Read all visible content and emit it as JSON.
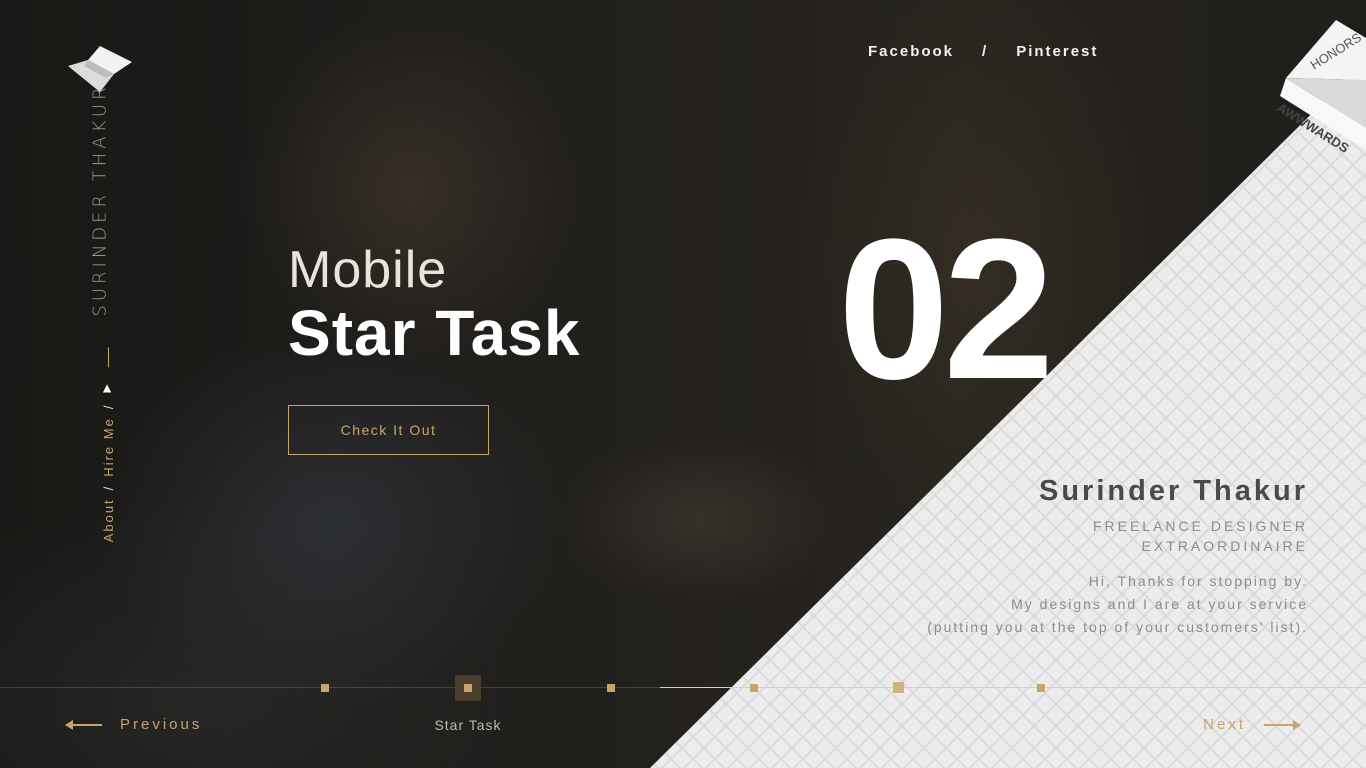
{
  "brand": {
    "name_vertical": "SURINDER THAKUR",
    "logo_icon": "s-monogram-logo"
  },
  "side_nav": {
    "about": "About",
    "hire": "Hire Me",
    "separator": "/",
    "home_icon": "home-icon"
  },
  "social": {
    "facebook": "Facebook",
    "separator": "/",
    "pinterest": "Pinterest"
  },
  "ribbon": {
    "top": "HONORS",
    "bottom": "AWWWARDS"
  },
  "hero": {
    "kicker": "Mobile",
    "title": "Star Task",
    "cta": "Check It Out",
    "number": "02"
  },
  "bio": {
    "name": "Surinder Thakur",
    "role_line1": "FREELANCE DESIGNER",
    "role_line2": "EXTRAORDINAIRE",
    "msg_line1": "Hi, Thanks for stopping by.",
    "msg_line2": "My designs and I are at your service",
    "msg_line3": "(putting you at the top of your customers' list)."
  },
  "footer_nav": {
    "previous": "Previous",
    "next": "Next",
    "current": "Star Task",
    "slide_count": 6,
    "active_slide": 2
  },
  "colors": {
    "accent_gold": "#c8a56a",
    "panel_light": "#ececec",
    "dark_bg": "#2b2a27",
    "bio_name": "#4a4a4a"
  }
}
